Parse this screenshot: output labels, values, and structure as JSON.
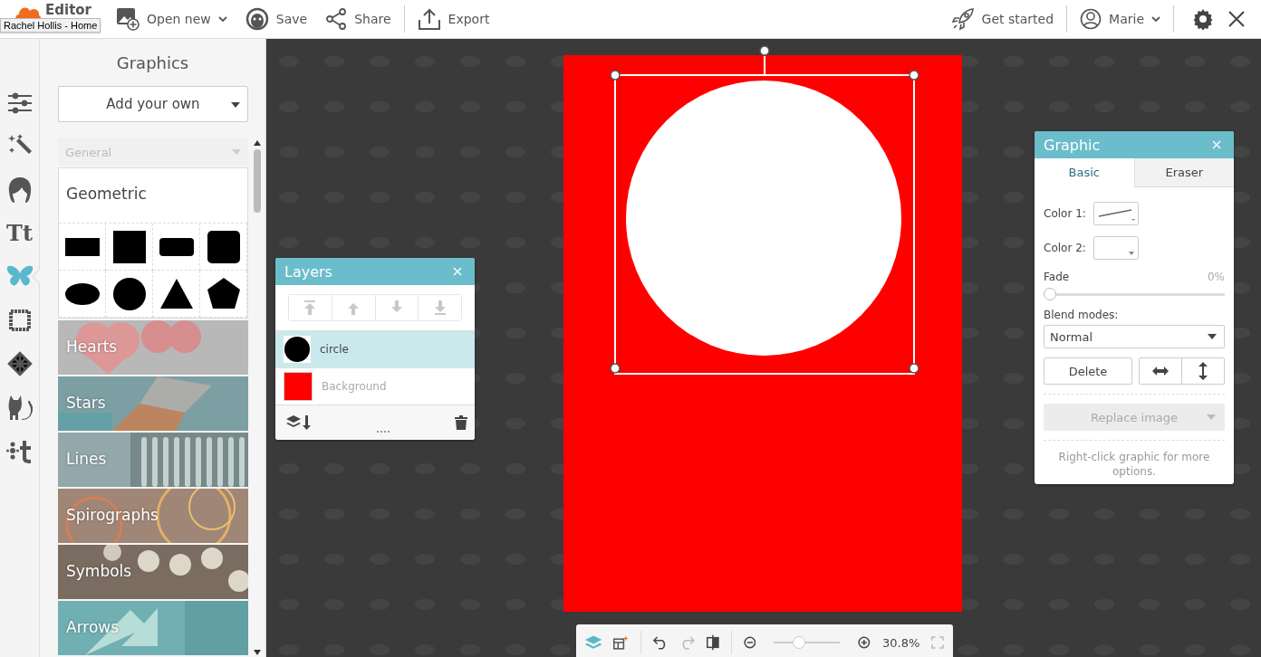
{
  "topbar": {
    "logo": "Editor",
    "tooltip": "Rachel Hollis - Home",
    "actions": [
      {
        "kind": "open",
        "label": "Open new",
        "dropdown": true
      },
      {
        "kind": "save",
        "label": "Save",
        "dropdown": false
      },
      {
        "kind": "share",
        "label": "Share",
        "dropdown": false
      },
      {
        "kind": "export",
        "label": "Export",
        "dropdown": false
      }
    ],
    "get_started": "Get started",
    "user": "Marie"
  },
  "sidebar": {
    "items": [
      {
        "kind": "adjust",
        "selected": false
      },
      {
        "kind": "effects",
        "selected": false
      },
      {
        "kind": "touchup",
        "selected": false
      },
      {
        "kind": "text",
        "label": "Tt",
        "selected": false
      },
      {
        "kind": "graphics",
        "selected": true
      },
      {
        "kind": "frames",
        "selected": false
      },
      {
        "kind": "textures",
        "selected": false
      },
      {
        "kind": "seasonal",
        "selected": false
      },
      {
        "kind": "stamp",
        "selected": false
      }
    ]
  },
  "graphics_panel": {
    "title": "Graphics",
    "add_button": "Add your own",
    "category_select": {
      "placeholder": "General"
    },
    "section_title": "Geometric",
    "shapes": [
      {
        "kind": "rectangle"
      },
      {
        "kind": "square"
      },
      {
        "kind": "rounded-rectangle"
      },
      {
        "kind": "rounded-square"
      },
      {
        "kind": "ellipse"
      },
      {
        "kind": "circle"
      },
      {
        "kind": "triangle"
      },
      {
        "kind": "pentagon"
      }
    ],
    "categories": [
      {
        "label": "Hearts"
      },
      {
        "label": "Stars"
      },
      {
        "label": "Lines"
      },
      {
        "label": "Spirographs"
      },
      {
        "label": "Symbols"
      },
      {
        "label": "Arrows"
      }
    ]
  },
  "layers": {
    "title": "Layers",
    "rows": [
      {
        "name": "circle",
        "kind": "shape",
        "selected": true
      },
      {
        "name": "Background",
        "kind": "fill",
        "selected": false
      }
    ]
  },
  "graphic_panel": {
    "title": "Graphic",
    "tabs": [
      {
        "label": "Basic",
        "selected": true
      },
      {
        "label": "Eraser",
        "selected": false
      }
    ],
    "color1_label": "Color 1:",
    "color2_label": "Color 2:",
    "fade": {
      "label": "Fade",
      "reading": "0%",
      "level": 0
    },
    "blend_label": "Blend modes:",
    "blend_value": "Normal",
    "delete": "Delete",
    "replace": {
      "label": "Replace image",
      "disabled": true
    },
    "hint": "Right-click graphic for more options."
  },
  "zoom": {
    "level": 0.38,
    "reading": "30.8%"
  }
}
